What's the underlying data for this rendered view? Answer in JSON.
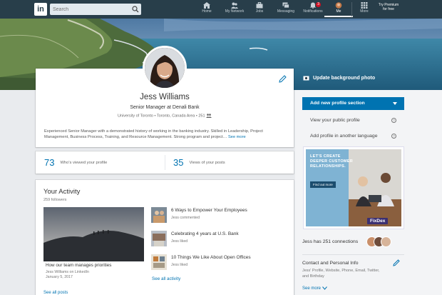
{
  "nav": {
    "logo": "in",
    "search_placeholder": "Search",
    "items": [
      {
        "label": "Home"
      },
      {
        "label": "My Network"
      },
      {
        "label": "Jobs"
      },
      {
        "label": "Messaging"
      },
      {
        "label": "Notifications",
        "badge": "3"
      },
      {
        "label": "Me"
      },
      {
        "label": "More"
      }
    ],
    "premium_line1": "Try Premium",
    "premium_line2": "for free"
  },
  "profile": {
    "name": "Jess Williams",
    "headline": "Senior Manager at Denali Bank",
    "location": "University of Toronto • Toronto, Canada Area • 251",
    "summary": "Experienced Senior Manager with a demonstrated history of working in the banking industry. Skilled in Leadership, Project Management, Business Process, Training, and Resource Management. Strong program and project…",
    "see_more": "See more"
  },
  "views": {
    "profile_views": "73",
    "profile_views_label": "Who's viewed your profile",
    "post_views": "35",
    "post_views_label": "Views of your posts"
  },
  "activity": {
    "title": "Your Activity",
    "followers": "259 followers",
    "post": {
      "title": "How our team manages priorities",
      "meta1": "Jess Williams on LinkedIn",
      "meta2": "January 5, 2017"
    },
    "see_all_posts": "See all posts",
    "items": [
      {
        "title": "6 Ways to Empower Your Employees",
        "meta": "Jess commented"
      },
      {
        "title": "Celebrating 4 years at U.S. Bank",
        "meta": "Jess liked"
      },
      {
        "title": "10 Things We Like About Open Offices",
        "meta": "Jess liked"
      }
    ],
    "see_all_activity": "See all activity"
  },
  "rail": {
    "update_bg": "Update background photo",
    "add_section": "Add new profile section",
    "view_public": "View your public profile",
    "add_language": "Add profile in another language",
    "ad": {
      "headline1": "LET'S CREATE",
      "headline2": "DEEPER CUSTOMER",
      "headline3": "RELATIONSHIPS.",
      "button": "Find out more",
      "brand": "FixDex"
    },
    "connections": "Jess has 251 connections",
    "contact_title": "Contact and Personal Info",
    "contact_sub": "Jess' Profile, Website, Phone, Email, Twitter, and Birthday",
    "see_more": "See more"
  },
  "colors": {
    "nav_bg": "#283e4a",
    "accent": "#0073b1",
    "page_bg": "#e9ebee"
  }
}
